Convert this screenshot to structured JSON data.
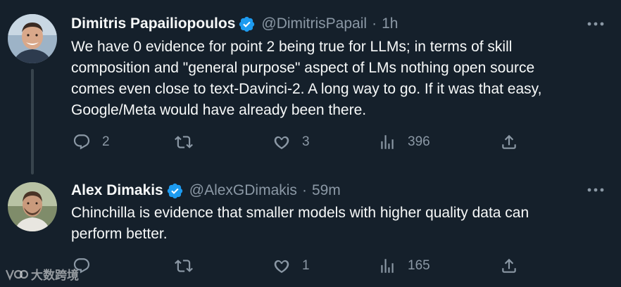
{
  "tweets": [
    {
      "display_name": "Dimitris Papailiopoulos",
      "handle": "@DimitrisPapail",
      "separator": "·",
      "time": "1h",
      "text": "We have 0 evidence for point 2 being true for LLMs; in terms of skill\ncomposition and \"general purpose\" aspect of LMs nothing open source\ncomes even close to text-Davinci-2. A long way to go. If it was that easy,\nGoogle/Meta would have already been there.",
      "replies": "2",
      "retweets": "",
      "likes": "3",
      "views": "396"
    },
    {
      "display_name": "Alex Dimakis",
      "handle": "@AlexGDimakis",
      "separator": "·",
      "time": "59m",
      "text": "Chinchilla is evidence that smaller models with higher quality data can\nperform better.",
      "replies": "",
      "retweets": "",
      "likes": "1",
      "views": "165"
    }
  ],
  "watermark": {
    "text": "大数跨境"
  },
  "colors": {
    "background": "#15202b",
    "text": "#f7f9f9",
    "secondary": "#8b98a5",
    "verified": "#1d9bf0",
    "thread_line": "#38444d"
  },
  "icons": [
    "verified-badge-icon",
    "more-options-icon",
    "reply-icon",
    "retweet-icon",
    "like-icon",
    "views-icon",
    "share-icon"
  ]
}
